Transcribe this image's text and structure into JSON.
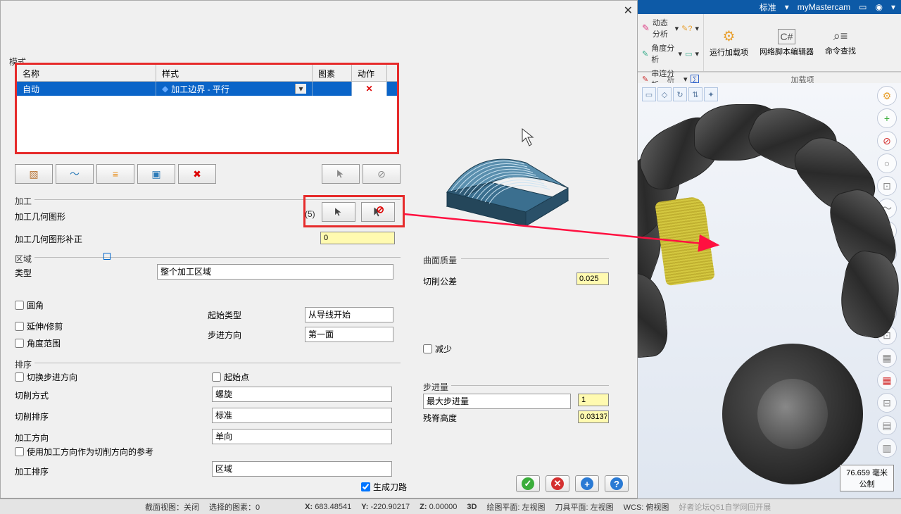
{
  "dialog": {
    "close": "✕",
    "pattern_label": "模式",
    "table_headers": {
      "name": "名称",
      "style": "样式",
      "icon": "图素",
      "action": "动作"
    },
    "table_row": {
      "name": "自动",
      "style": "加工边界 - 平行",
      "action": "✕"
    },
    "machining": "加工",
    "geom_shape": "加工几何图形",
    "geom_count": "(5)",
    "geom_comp": "加工几何图形补正",
    "geom_comp_val": "0",
    "area": "区域",
    "type": "类型",
    "type_val": "整个加工区域",
    "fillet": "圆角",
    "extend_trim": "延伸/修剪",
    "angle_range": "角度范围",
    "start_type": "起始类型",
    "start_type_val": "从导线开始",
    "step_direction": "步进方向",
    "step_direction_val": "第一面",
    "sort": "排序",
    "toggle_step_dir": "切换步进方向",
    "start_point": "起始点",
    "cut_method": "切削方式",
    "cut_method_val": "螺旋",
    "cut_sort": "切削排序",
    "cut_sort_val": "标准",
    "machining_dir": "加工方向",
    "machining_dir_val": "单向",
    "use_machining_dir_ref": "使用加工方向作为切削方向的参考",
    "machining_sort": "加工排序",
    "machining_sort_val": "区域",
    "generate_toolpath": "生成刀路"
  },
  "preview": {
    "surface_quality": "曲面质量",
    "cut_tolerance": "切削公差",
    "cut_tolerance_val": "0.025",
    "reduce": "减少",
    "step_amount": "步进量",
    "step_amount_sel": "最大步进量",
    "step_amount_val": "1",
    "scallop_height": "残脊高度",
    "scallop_height_val": "0.03137"
  },
  "ribbon": {
    "std": "标准",
    "app": "myMastercam",
    "dyn_analysis": "动态分析",
    "angle_analysis": "角度分析",
    "chain_analysis": "串连分析",
    "xi": "析",
    "run_addon": "运行加载项",
    "script_editor": "网络脚本编辑器",
    "cmd_find": "命令查找",
    "addons": "加载项"
  },
  "viewport": {
    "scale_value": "76.659 毫米",
    "scale_unit": "公制"
  },
  "statusbar": {
    "section_view": "截面视图：关闭",
    "selected": "选择的图素：0",
    "x": "X:",
    "xv": "683.48541",
    "y": "Y:",
    "yv": "-220.90217",
    "z": "Z:",
    "zv": "0.00000",
    "mode3d": "3D",
    "drawing_plane": "绘图平面: 左视图",
    "tool_plane": "刀具平面: 左视图",
    "wcs": "WCS: 俯视图",
    "watermark": "好者论坛Q51自学网回开展"
  }
}
